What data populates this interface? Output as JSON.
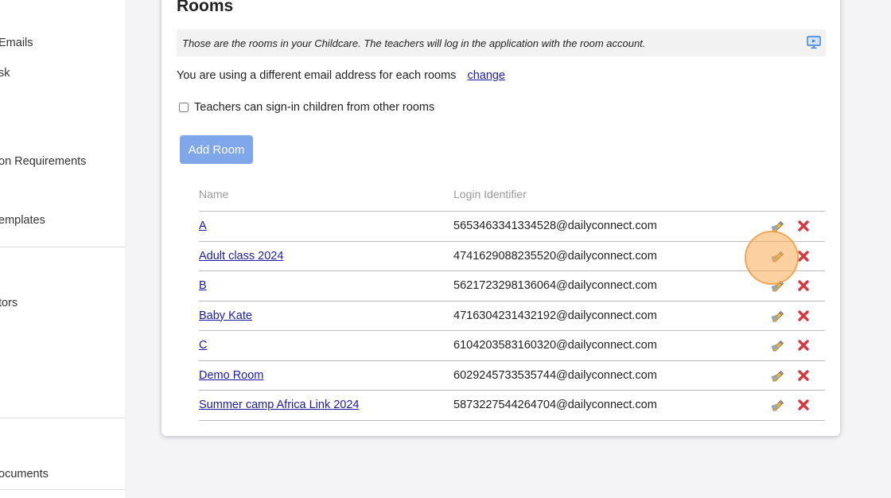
{
  "sidebar": {
    "items": [
      {
        "label": "Emails",
        "top": 0
      },
      {
        "label": "sk",
        "top": 0
      },
      {
        "label": "on Requirements",
        "top": 0
      },
      {
        "label": "emplates",
        "top": 0
      },
      {
        "label": "tors",
        "top": 0
      },
      {
        "label": "ocuments",
        "top": 0
      }
    ]
  },
  "rooms": {
    "title": "Rooms",
    "info_text": "Those are the rooms in your Childcare. The teachers will log in the application with the room account.",
    "email_text": "You are using a different email address for each rooms",
    "change_link": "change",
    "checkbox_label": "Teachers can sign-in children from other rooms",
    "checkbox_checked": false,
    "add_button": "Add Room",
    "columns": [
      "Name",
      "Login Identifier"
    ],
    "rows": [
      {
        "name": "A",
        "login": "5653463341334528@dailyconnect.com"
      },
      {
        "name": "Adult class 2024",
        "login": "4741629088235520@dailyconnect.com"
      },
      {
        "name": "B",
        "login": "5621723298136064@dailyconnect.com"
      },
      {
        "name": "Baby Kate",
        "login": "4716304231432192@dailyconnect.com"
      },
      {
        "name": "C",
        "login": "6104203583160320@dailyconnect.com"
      },
      {
        "name": "Demo Room",
        "login": "6029245733535744@dailyconnect.com"
      },
      {
        "name": "Summer camp Africa Link 2024",
        "login": "5873227544264704@dailyconnect.com"
      }
    ]
  },
  "icons": {
    "info": "presentation-screen-icon",
    "edit": "edit-pencil-icon",
    "delete": "delete-x-icon"
  },
  "colors": {
    "button": "#7fa7e9",
    "link": "#1a1aa6",
    "delete": "#d9363e",
    "highlight": "#f5a04a"
  }
}
